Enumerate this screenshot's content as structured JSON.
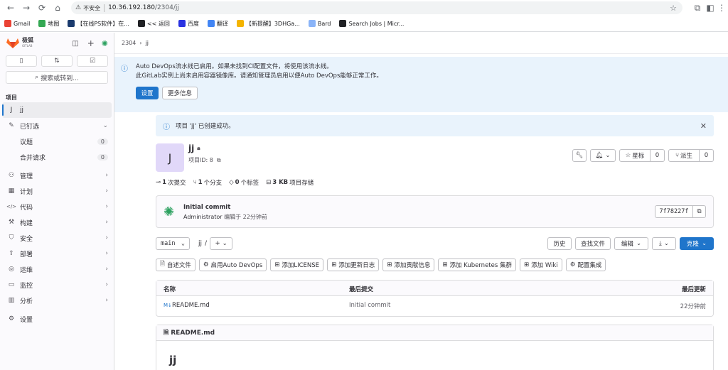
{
  "browser": {
    "insecure_label": "不安全",
    "url_host": "10.36.192.180",
    "url_path": "/2304/jj",
    "bookmarks": [
      {
        "label": "Gmail",
        "color": "#ea4335"
      },
      {
        "label": "地图",
        "color": "#34a853"
      },
      {
        "label": "【在线PS软件】在...",
        "color": "#1a3b6e"
      },
      {
        "label": "<< 返回",
        "color": "#202124"
      },
      {
        "label": "百度",
        "color": "#2932e1"
      },
      {
        "label": "翻译",
        "color": "#4285f4"
      },
      {
        "label": "【新提醒】3DHGa...",
        "color": "#f4b400"
      },
      {
        "label": "Bard",
        "color": "#8ab4f8"
      },
      {
        "label": "Search Jobs | Micr...",
        "color": "#202124"
      }
    ]
  },
  "sidebar": {
    "logo_text": "极狐",
    "logo_sub": "GITLAB",
    "search_label": "搜索或转到...",
    "section_label": "项目",
    "project_letter": "J",
    "project_name": "jj",
    "pinned_label": "已钉选",
    "issues_label": "议题",
    "issues_count": "0",
    "mr_label": "合并请求",
    "mr_count": "0",
    "items": [
      {
        "label": "管理",
        "icon": "manage-icon"
      },
      {
        "label": "计划",
        "icon": "plan-icon"
      },
      {
        "label": "代码",
        "icon": "code-icon"
      },
      {
        "label": "构建",
        "icon": "build-icon"
      },
      {
        "label": "安全",
        "icon": "shield-icon"
      },
      {
        "label": "部署",
        "icon": "deploy-icon"
      },
      {
        "label": "运维",
        "icon": "operate-icon"
      },
      {
        "label": "监控",
        "icon": "monitor-icon"
      },
      {
        "label": "分析",
        "icon": "analytics-icon"
      }
    ],
    "settings_label": "设置"
  },
  "breadcrumb": {
    "group": "2304",
    "project": "jj"
  },
  "devops_alert": {
    "line1": "Auto DevOps流水线已启用。如果未找到CI配置文件，将使用该流水线。",
    "line2": "此GitLab实例上尚未启用容器镜像库。请通知管理员启用以便Auto DevOps能够正常工作。",
    "settings_button": "设置",
    "more_button": "更多信息"
  },
  "success_alert": {
    "text": "项目 'jj' 已创建成功。"
  },
  "project": {
    "avatar_letter": "J",
    "name": "jj",
    "id_label": "项目ID: 8",
    "star_label": "星标",
    "star_count": "0",
    "fork_label": "派生",
    "fork_count": "0"
  },
  "stats": {
    "commits_num": "1",
    "commits_label": "次提交",
    "branches_num": "1",
    "branches_label": "个分支",
    "tags_num": "0",
    "tags_label": "个标签",
    "storage_num": "3 KB",
    "storage_label": "项目存储"
  },
  "commit": {
    "title": "Initial commit",
    "author": "Administrator",
    "meta": "编辑于 22分钟前",
    "sha": "7f78227f"
  },
  "toolbar": {
    "branch": "main",
    "path_project": "jj",
    "path_sep": "/",
    "history": "历史",
    "find_file": "查找文件",
    "edit": "编辑",
    "clone": "克隆"
  },
  "actions": [
    {
      "label": "自述文件",
      "icon": "readme-icon"
    },
    {
      "label": "启用Auto DevOps",
      "icon": "gear-icon"
    },
    {
      "label": "添加LICENSE",
      "icon": "plus-square-icon"
    },
    {
      "label": "添加更新日志",
      "icon": "plus-square-icon"
    },
    {
      "label": "添加贡献信息",
      "icon": "plus-square-icon"
    },
    {
      "label": "添加 Kubernetes 集群",
      "icon": "plus-square-icon"
    },
    {
      "label": "添加 Wiki",
      "icon": "plus-square-icon"
    },
    {
      "label": "配置集成",
      "icon": "gear-icon"
    }
  ],
  "file_table": {
    "col_name": "名称",
    "col_commit": "最后提交",
    "col_updated": "最后更新",
    "rows": [
      {
        "name": "README.md",
        "commit": "Initial commit",
        "updated": "22分钟前"
      }
    ]
  },
  "readme": {
    "header": "README.md",
    "heading": "jj"
  }
}
